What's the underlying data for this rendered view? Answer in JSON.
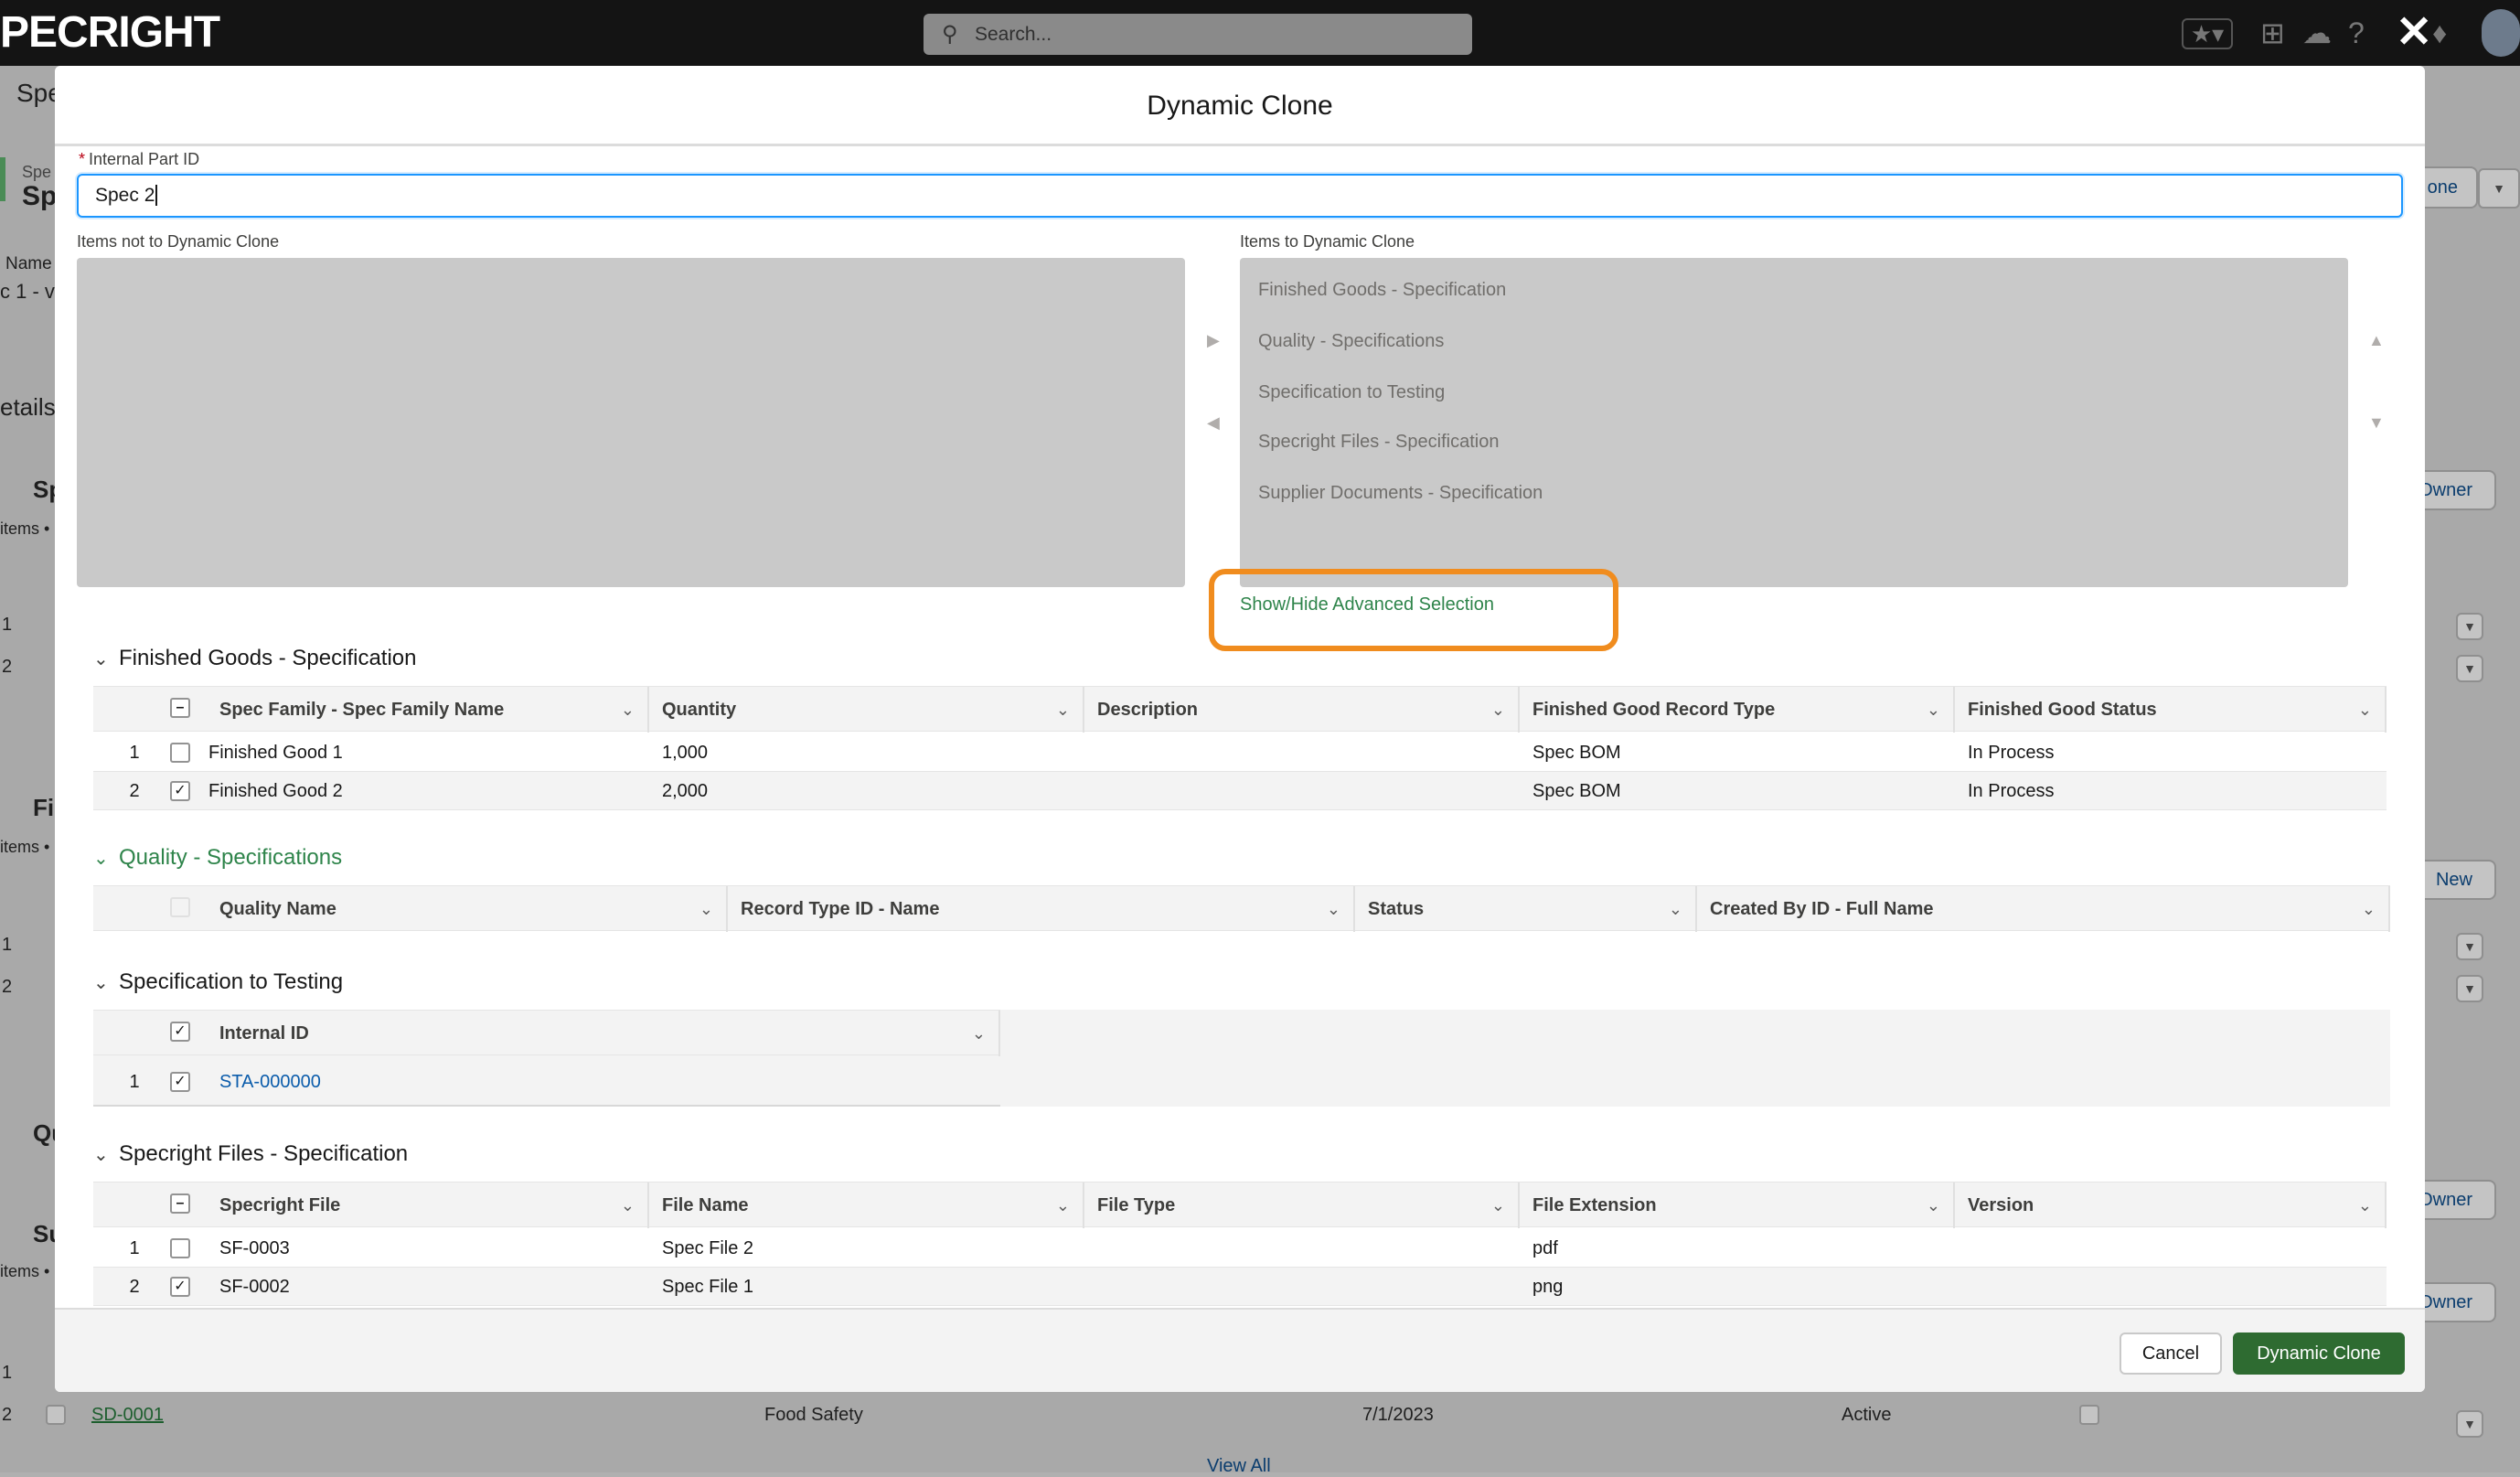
{
  "topbar": {
    "logo": "PECRIGHT",
    "search_placeholder": "Search..."
  },
  "background": {
    "tab": "Spe",
    "record_prefix": "Spe",
    "record_title": "Sp",
    "name_label": "Name",
    "name_value": "c 1 - ve",
    "details_tab": "etails",
    "sections": [
      {
        "title": "Sp",
        "meta": "items •"
      },
      {
        "title": "Fi",
        "meta": "items •"
      },
      {
        "title": "Qu",
        "meta": ""
      },
      {
        "title": "Su",
        "meta": "items •"
      }
    ],
    "row_nums": [
      "1",
      "2",
      "1",
      "2",
      "1",
      "2",
      "1",
      "2"
    ],
    "right_buttons": {
      "clone": "one",
      "owner1": "Owner",
      "new": "New",
      "owner2": "Owner",
      "owner3": "Owner"
    },
    "bottom_row": {
      "num": "2",
      "id": "SD-0001",
      "type": "Food Safety",
      "date": "7/1/2023",
      "status": "Active"
    },
    "view_all": "View All"
  },
  "modal": {
    "title": "Dynamic Clone",
    "part_id_label": "Internal Part ID",
    "part_id_value": "Spec 2",
    "left_list_label": "Items not to Dynamic Clone",
    "right_list_label": "Items to Dynamic Clone",
    "right_list_items": [
      "Finished Goods - Specification",
      "Quality - Specifications",
      "Specification to Testing",
      "Specright Files - Specification",
      "Supplier Documents - Specification"
    ],
    "advanced_link": "Show/Hide Advanced Selection",
    "finished_goods": {
      "title": "Finished Goods - Specification",
      "columns": [
        "Spec Family - Spec Family Name",
        "Quantity",
        "Description",
        "Finished Good Record Type",
        "Finished Good Status"
      ],
      "rows": [
        {
          "num": "1",
          "checked": false,
          "cells": [
            "Finished Good 1",
            "1,000",
            "",
            "Spec BOM",
            "In Process"
          ]
        },
        {
          "num": "2",
          "checked": true,
          "cells": [
            "Finished Good 2",
            "2,000",
            "",
            "Spec BOM",
            "In Process"
          ]
        }
      ]
    },
    "quality": {
      "title": "Quality - Specifications",
      "columns": [
        "Quality Name",
        "Record Type ID - Name",
        "Status",
        "Created By ID - Full Name"
      ]
    },
    "testing": {
      "title": "Specification to Testing",
      "columns": [
        "Internal ID"
      ],
      "rows": [
        {
          "num": "1",
          "checked": true,
          "cells": [
            "STA-000000"
          ]
        }
      ]
    },
    "files": {
      "title": "Specright Files - Specification",
      "columns": [
        "Specright File",
        "File Name",
        "File Type",
        "File Extension",
        "Version"
      ],
      "rows": [
        {
          "num": "1",
          "checked": false,
          "cells": [
            "SF-0003",
            "Spec File 2",
            "",
            "pdf",
            ""
          ]
        },
        {
          "num": "2",
          "checked": true,
          "cells": [
            "SF-0002",
            "Spec File 1",
            "",
            "png",
            ""
          ]
        }
      ]
    },
    "cancel_label": "Cancel",
    "clone_label": "Dynamic Clone"
  }
}
